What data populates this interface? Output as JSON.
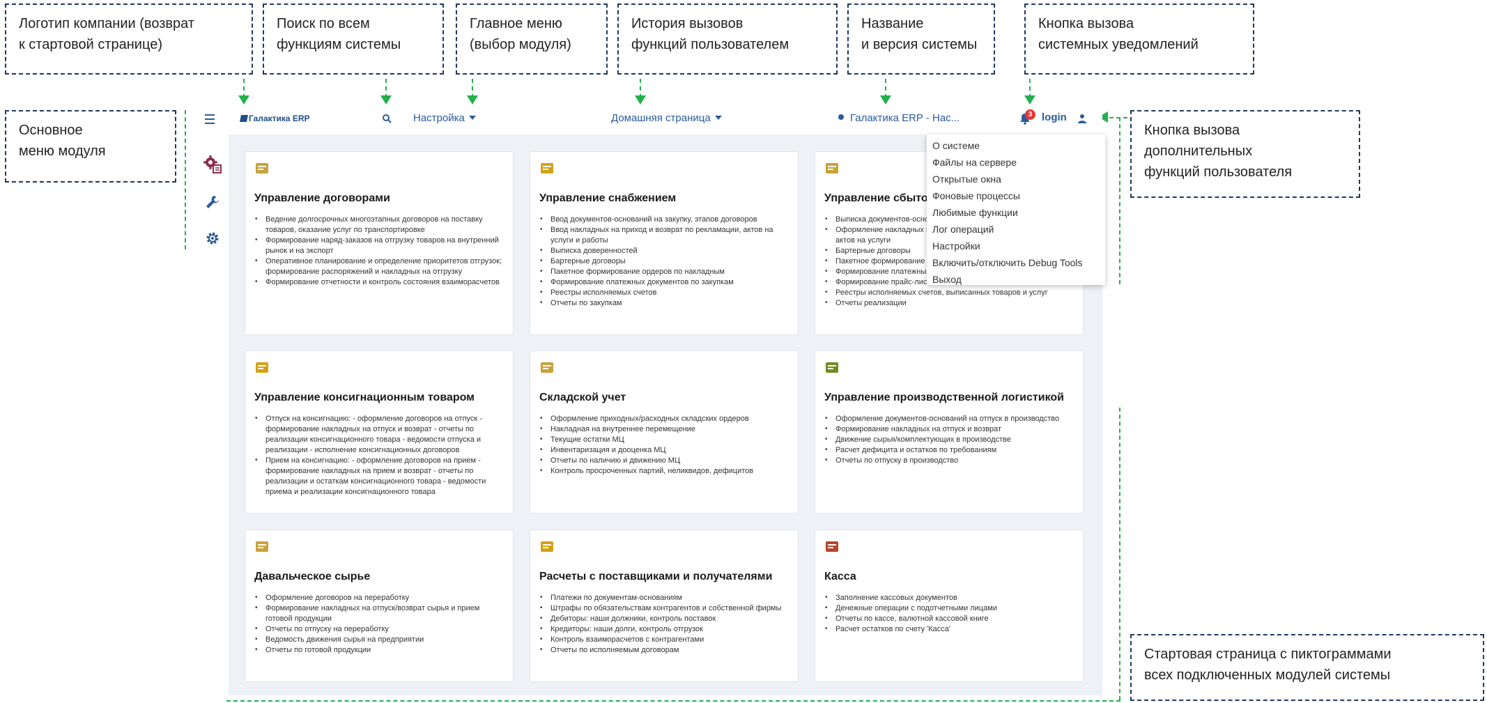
{
  "callouts": {
    "logo": [
      "Логотип компании (возврат",
      "к стартовой странице)"
    ],
    "search": [
      "Поиск по всем",
      "функциям системы"
    ],
    "main_menu": [
      "Главное меню",
      "(выбор модуля)"
    ],
    "history": [
      "История вызовов",
      "функций пользователем"
    ],
    "system_name": [
      "Название",
      "и версия системы"
    ],
    "notifications": [
      "Кнопка вызова",
      "системных уведомлений"
    ],
    "module_menu": [
      "Основное",
      "меню модуля"
    ],
    "user_functions": [
      "Кнопка вызова",
      "дополнительных",
      "функций пользователя"
    ],
    "start_page": [
      "Стартовая страница с пиктограммами",
      "всех подключенных модулей системы"
    ]
  },
  "header": {
    "logo_text": "Галактика ERP",
    "module_menu_label": "Настройка",
    "history_label": "Домашняя страница",
    "system_name": "Галактика ERP - Нас...",
    "notification_count": "3",
    "login_label": "login"
  },
  "icons": {
    "hamburger": "menu-icon",
    "search": "search-icon",
    "bell": "bell-icon",
    "user": "user-icon",
    "side": [
      "settings-module-icon",
      "wrench-icon",
      "gear-icon"
    ]
  },
  "colors": {
    "accent": "#2a5b9a",
    "guide": "#22b14c",
    "callout_border": "#1f3864",
    "badge": "#e53935"
  },
  "user_menu": [
    "О системе",
    "Файлы на сервере",
    "Открытые окна",
    "Фоновые процессы",
    "Любимые функции",
    "Лог операций",
    "Настройки",
    "Включить/отключить Debug Tools",
    "Выход"
  ],
  "cards": [
    {
      "title": "Управление договорами",
      "icon": "contract-icon",
      "items": [
        "Ведение долгосрочных многоэтапных договоров на поставку товаров, оказание услуг по транспортировке",
        "Формирование наряд-заказов на отгрузку товаров на внутренний рынок и на экспорт",
        "Оперативное планирование и определение приоритетов отгрузок; формирование распоряжений и накладных на отгрузку",
        "Формирование отчетности и контроль состояния взаиморасчетов"
      ]
    },
    {
      "title": "Управление снабжением",
      "icon": "truck-icon",
      "items": [
        "Ввод документов-оснований на закупку, этапов договоров",
        "Ввод накладных на приход и возврат по рекламации, актов на услуги и работы",
        "Выписка доверенностей",
        "Бартерные договоры",
        "Пакетное формирование ордеров по накладным",
        "Формирование платежных документов по закупкам",
        "Реестры исполняемых счетов",
        "Отчеты по закупкам"
      ]
    },
    {
      "title": "Управление сбытом",
      "icon": "sales-icon",
      "items": [
        "Выписка документов-оснований на продажу, этапов договоров",
        "Оформление накладных на отпуск и возврат по рекламации, актов на услуги",
        "Бартерные договоры",
        "Пакетное формирование ордеров",
        "Формирование платежных документов",
        "Формирование прайс-листов",
        "Реестры исполняемых счетов, выписанных товаров и услуг",
        "Отчеты реализации"
      ]
    },
    {
      "title": "Управление консигнационным товаром",
      "icon": "consignment-icon",
      "items": [
        "Отпуск на консигнацию: - оформление договоров на отпуск - формирование накладных на отпуск и возврат - отчеты по реализации консигнационного товара - ведомости отпуска и реализации - исполнение консигнационных договоров",
        "Прием на консигнацию: - оформление договоров на прием - формирование накладных на прием и возврат - отчеты по реализации и остаткам консигнационного товара - ведомости приема и реализации консигнационного товара"
      ]
    },
    {
      "title": "Складской учет",
      "icon": "warehouse-icon",
      "items": [
        "Оформление приходных/расходных складских ордеров",
        "Накладная на внутреннее перемещение",
        "Текущие остатки МЦ",
        "Инвентаризация и дооценка МЦ",
        "Отчеты по наличию и движению МЦ",
        "Контроль просроченных партий, неликвидов, дефицитов"
      ]
    },
    {
      "title": "Управление производственной логистикой",
      "icon": "production-icon",
      "items": [
        "Оформление документов-оснований на отпуск в производство",
        "Формирование накладных на отпуск и возврат",
        "Движение сырья/комплектующих в производстве",
        "Расчет дефицита и остатков по требованиям",
        "Отчеты по отпуску в производство"
      ]
    },
    {
      "title": "Давальческое сырье",
      "icon": "raw-material-icon",
      "items": [
        "Оформление договоров на переработку",
        "Формирование накладных на отпуск/возврат сырья и прием готовой продукции",
        "Отчеты по отпуску на переработку",
        "Ведомость движения сырья на предприятии",
        "Отчеты по готовой продукции"
      ]
    },
    {
      "title": "Расчеты с поставщиками и получателями",
      "icon": "settlements-icon",
      "items": [
        "Платежи по документам-основаниям",
        "Штрафы по обязательствам контрагентов и собственной фирмы",
        "Дебиторы: наши должники, контроль поставок",
        "Кредиторы: наши долги, контроль отгрузок",
        "Контроль взаиморасчетов с контрагентами",
        "Отчеты по исполняемым договорам"
      ]
    },
    {
      "title": "Касса",
      "icon": "cashbox-icon",
      "items": [
        "Заполнение кассовых документов",
        "Денежные операции с подотчетными лицами",
        "Отчеты по кассе, валютной кассовой книге",
        "Расчет остатков по счету 'Касса'"
      ]
    }
  ]
}
